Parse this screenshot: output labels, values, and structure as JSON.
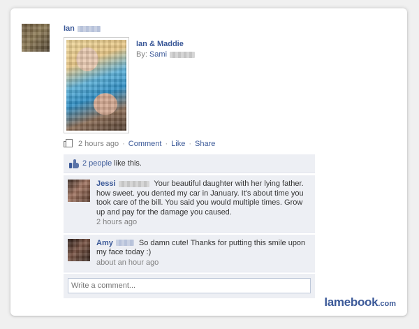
{
  "post": {
    "author": "Ian",
    "album_title": "Ian & Maddie",
    "album_by_prefix": "By:",
    "album_by_name": "Sami",
    "timestamp": "2 hours ago",
    "actions": {
      "comment": "Comment",
      "like": "Like",
      "share": "Share"
    }
  },
  "likes": {
    "count_text": "2 people",
    "suffix": "like this."
  },
  "comments": [
    {
      "author": "Jessi",
      "text": "Your beautiful daughter with her lying father. how sweet. you dented my car in January. It's about time you took care of the bill. You said you would multiple times. Grow up and pay for the damage you caused.",
      "time": "2 hours ago"
    },
    {
      "author": "Amy",
      "text": "So damn cute! Thanks for putting this smile upon my face today :)",
      "time": "about an hour ago"
    }
  ],
  "composer": {
    "placeholder": "Write a comment..."
  },
  "watermark": {
    "main": "lamebook",
    "suffix": ".com"
  },
  "icons": {
    "album": "album-icon",
    "like": "thumbs-up-icon"
  },
  "colors": {
    "link": "#3b5998",
    "feedback_bg": "#edeff4",
    "meta_text": "#808080"
  }
}
